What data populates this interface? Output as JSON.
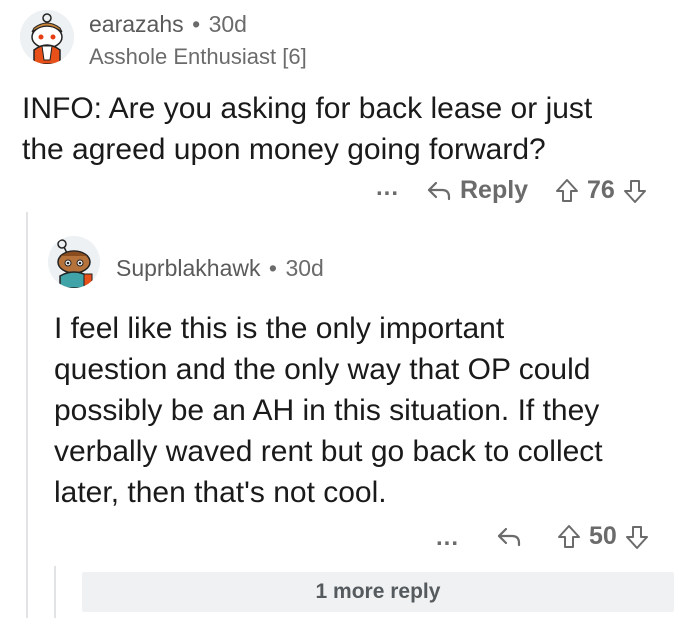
{
  "comment": {
    "username": "earazahs",
    "separator": "•",
    "age": "30d",
    "flair": "Asshole Enthusiast [6]",
    "body_line1": "INFO: Are you asking for back lease or just",
    "body_line2": "the agreed upon money going forward?",
    "more_label": "...",
    "reply_label": "Reply",
    "score": "76"
  },
  "reply": {
    "username": "Suprblakhawk",
    "separator": "•",
    "age": "30d",
    "body_line1": "I feel like this is the only important",
    "body_line2": "question and the only way that OP could",
    "body_line3": "possibly be an AH in this situation. If they",
    "body_line4": "verbally waved rent but go back to collect",
    "body_line5": "later, then that's not cool.",
    "more_label": "...",
    "score": "50"
  },
  "more_replies_label": "1 more reply",
  "colors": {
    "text": "#1a1a1b",
    "meta": "#6b6b6b",
    "thread_line": "#e1e3e5",
    "more_bg": "#f0f1f2"
  }
}
